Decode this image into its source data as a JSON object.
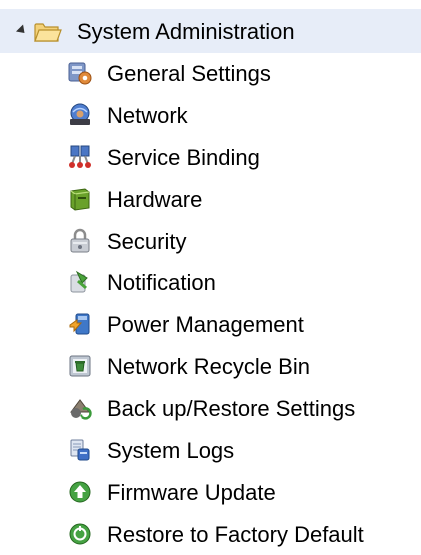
{
  "tree": {
    "root": {
      "label": "System Administration",
      "expanded": true,
      "icon": "folder-icon"
    },
    "items": [
      {
        "label": "General Settings",
        "icon": "general-settings-icon"
      },
      {
        "label": "Network",
        "icon": "network-icon"
      },
      {
        "label": "Service Binding",
        "icon": "service-binding-icon"
      },
      {
        "label": "Hardware",
        "icon": "hardware-icon"
      },
      {
        "label": "Security",
        "icon": "security-lock-icon"
      },
      {
        "label": "Notification",
        "icon": "notification-icon"
      },
      {
        "label": "Power Management",
        "icon": "power-management-icon"
      },
      {
        "label": "Network Recycle Bin",
        "icon": "recycle-bin-icon"
      },
      {
        "label": "Back up/Restore Settings",
        "icon": "backup-restore-icon"
      },
      {
        "label": "System Logs",
        "icon": "system-logs-icon"
      },
      {
        "label": "Firmware Update",
        "icon": "firmware-update-icon"
      },
      {
        "label": "Restore to Factory Default",
        "icon": "factory-default-icon"
      }
    ]
  },
  "colors": {
    "selected_row_bg": "#e7edf8",
    "text": "#000000"
  }
}
